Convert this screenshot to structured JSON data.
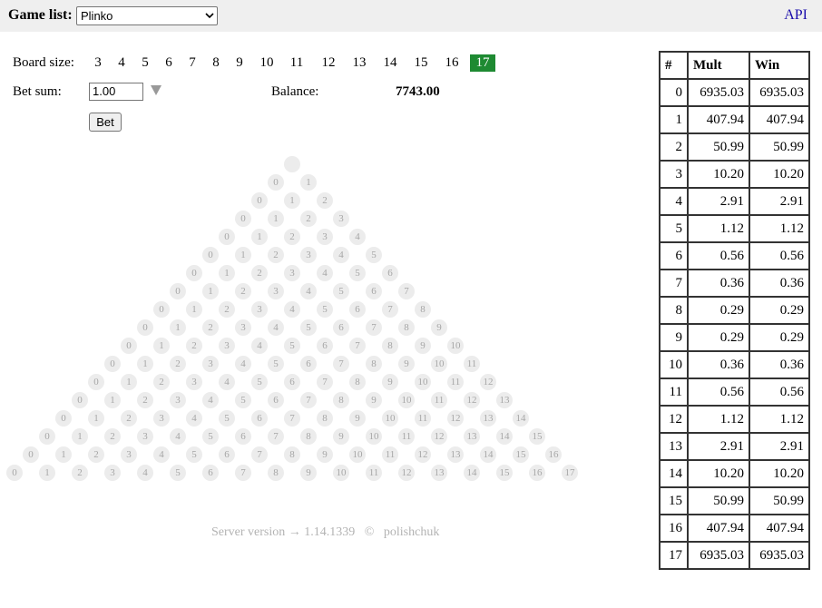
{
  "header": {
    "game_list_label": "Game list:",
    "selected_game": "Plinko",
    "api_link": "API"
  },
  "controls": {
    "board_size_label": "Board size:",
    "board_sizes": [
      "3",
      "4",
      "5",
      "6",
      "7",
      "8",
      "9",
      "10",
      "11",
      "12",
      "13",
      "14",
      "15",
      "16",
      "17"
    ],
    "selected_board_size": "17",
    "bet_sum_label": "Bet sum:",
    "bet_sum_value": "1.00",
    "balance_label": "Balance:",
    "balance_value": "7743.00",
    "bet_button": "Bet"
  },
  "board": {
    "rows": 17,
    "peg_color": "#ececec",
    "peg_text_color": "#a6a6a6"
  },
  "footer": {
    "version_text": "Server version → 1.14.1339",
    "copyright": "©",
    "author": "polishchuk"
  },
  "table": {
    "headers": [
      "#",
      "Mult",
      "Win"
    ],
    "rows": [
      [
        "0",
        "6935.03",
        "6935.03"
      ],
      [
        "1",
        "407.94",
        "407.94"
      ],
      [
        "2",
        "50.99",
        "50.99"
      ],
      [
        "3",
        "10.20",
        "10.20"
      ],
      [
        "4",
        "2.91",
        "2.91"
      ],
      [
        "5",
        "1.12",
        "1.12"
      ],
      [
        "6",
        "0.56",
        "0.56"
      ],
      [
        "7",
        "0.36",
        "0.36"
      ],
      [
        "8",
        "0.29",
        "0.29"
      ],
      [
        "9",
        "0.29",
        "0.29"
      ],
      [
        "10",
        "0.36",
        "0.36"
      ],
      [
        "11",
        "0.56",
        "0.56"
      ],
      [
        "12",
        "1.12",
        "1.12"
      ],
      [
        "13",
        "2.91",
        "2.91"
      ],
      [
        "14",
        "10.20",
        "10.20"
      ],
      [
        "15",
        "50.99",
        "50.99"
      ],
      [
        "16",
        "407.94",
        "407.94"
      ],
      [
        "17",
        "6935.03",
        "6935.03"
      ]
    ]
  },
  "colors": {
    "active_board_size": "#1e8a32",
    "link": "#1a0dab",
    "topbar": "#efefef"
  }
}
